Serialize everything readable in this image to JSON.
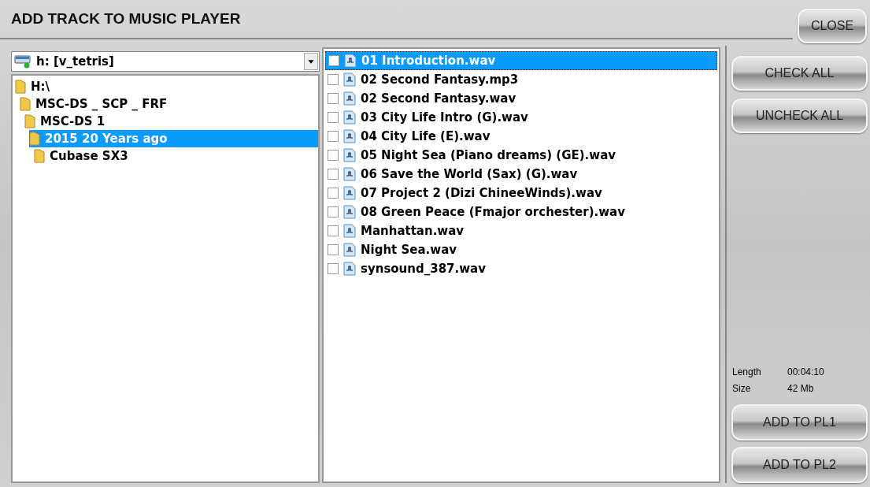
{
  "window": {
    "title": "ADD TRACK TO MUSIC PLAYER"
  },
  "close_button": "CLOSE",
  "drive": {
    "value": "h: [v_tetris]"
  },
  "tree": [
    {
      "label": "H:\\",
      "selected": false,
      "children": [
        {
          "label": "MSC-DS _ SCP _ FRF",
          "selected": false,
          "children": [
            {
              "label": "MSC-DS 1",
              "selected": false,
              "children": [
                {
                  "label": "2015 20 Years ago",
                  "selected": true,
                  "children": [
                    {
                      "label": "Cubase SX3",
                      "selected": false
                    }
                  ]
                }
              ]
            }
          ]
        }
      ]
    }
  ],
  "files": [
    {
      "name": "01 Introduction.wav",
      "checked": false,
      "selected": true
    },
    {
      "name": "02 Second Fantasy.mp3",
      "checked": false,
      "selected": false
    },
    {
      "name": "02 Second Fantasy.wav",
      "checked": false,
      "selected": false
    },
    {
      "name": "03 City Life Intro (G).wav",
      "checked": false,
      "selected": false
    },
    {
      "name": "04 City Life (E).wav",
      "checked": false,
      "selected": false
    },
    {
      "name": "05 Night Sea (Piano dreams) (GE).wav",
      "checked": false,
      "selected": false
    },
    {
      "name": "06 Save the World (Sax) (G).wav",
      "checked": false,
      "selected": false
    },
    {
      "name": "07 Project 2 (Dizi ChineeWinds).wav",
      "checked": false,
      "selected": false
    },
    {
      "name": "08 Green Peace (Fmajor orchester).wav",
      "checked": false,
      "selected": false
    },
    {
      "name": "Manhattan.wav",
      "checked": false,
      "selected": false
    },
    {
      "name": "Night Sea.wav",
      "checked": false,
      "selected": false
    },
    {
      "name": "synsound_387.wav",
      "checked": false,
      "selected": false
    }
  ],
  "side_buttons": [
    "CHECK ALL",
    "UNCHECK ALL"
  ],
  "info": [
    {
      "label": "Length",
      "value": "00:04:10"
    },
    {
      "label": "Size",
      "value": "42 Mb"
    }
  ],
  "add_buttons": [
    "ADD TO PL1",
    "ADD TO PL2"
  ]
}
